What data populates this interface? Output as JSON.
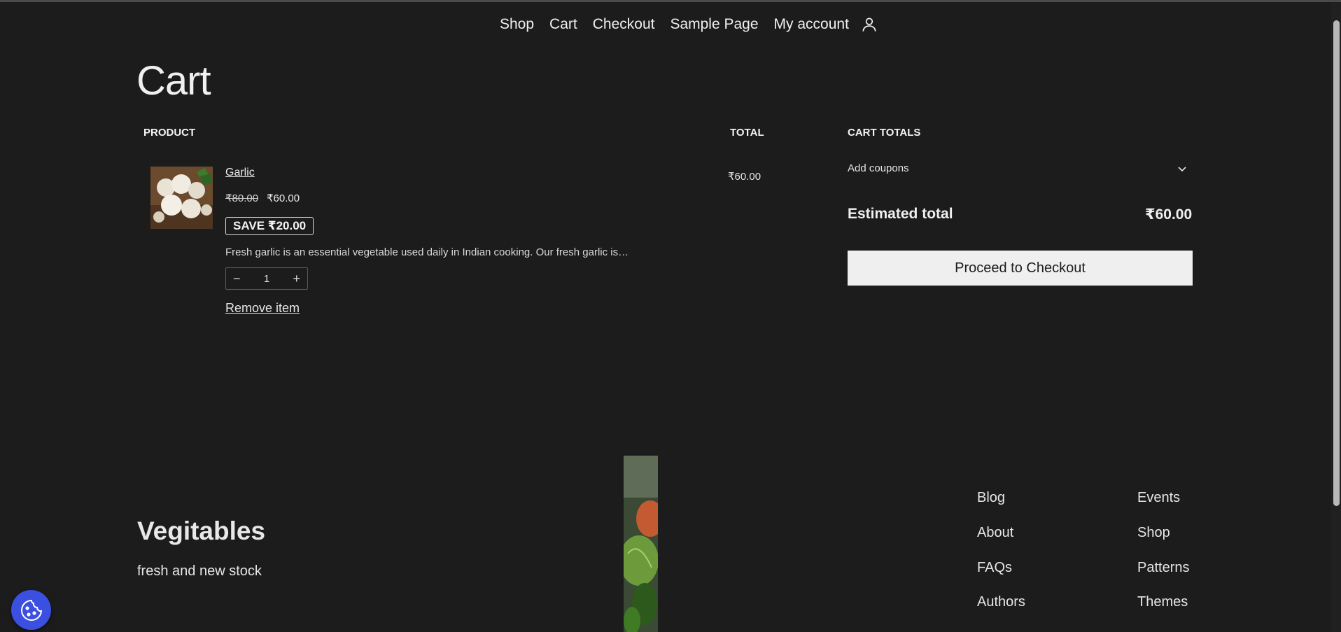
{
  "nav": {
    "items": [
      "Shop",
      "Cart",
      "Checkout",
      "Sample Page",
      "My account"
    ],
    "account_icon": "user-icon"
  },
  "page": {
    "title": "Cart"
  },
  "cart": {
    "headers": {
      "product": "PRODUCT",
      "total": "TOTAL",
      "cart_totals": "CART TOTALS"
    },
    "item": {
      "name": "Garlic",
      "regular_price": "₹80.00",
      "sale_price": "₹60.00",
      "save_badge": "SAVE ₹20.00",
      "description": "Fresh garlic is an essential vegetable used daily in Indian cooking. Our fresh garlic is…",
      "quantity": "1",
      "remove_label": "Remove item",
      "line_total": "₹60.00"
    },
    "totals": {
      "coupon_label": "Add coupons",
      "estimated_label": "Estimated total",
      "estimated_value": "₹60.00",
      "checkout_label": "Proceed to Checkout"
    }
  },
  "footer": {
    "site_title": "Vegitables",
    "tagline": "fresh and new stock",
    "links_col1": [
      "Blog",
      "About",
      "FAQs",
      "Authors"
    ],
    "links_col2": [
      "Events",
      "Shop",
      "Patterns",
      "Themes"
    ]
  },
  "cookie_widget": {
    "icon": "cookie-icon",
    "color": "#3b4fe0"
  },
  "colors": {
    "background": "#1c1c1c",
    "text": "#e9e9e9",
    "button_bg": "#efefef"
  }
}
